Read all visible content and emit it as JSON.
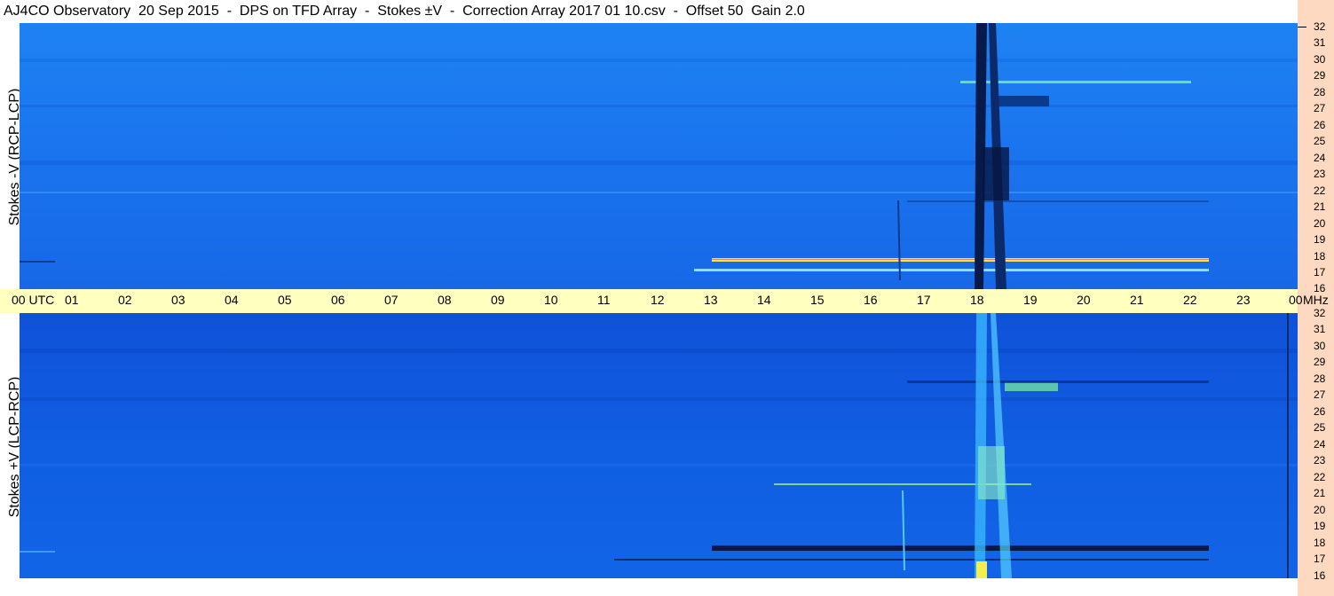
{
  "title": "AJ4CO Observatory  20 Sep 2015  -  DPS on TFD Array  -  Stokes ±V  -  Correction Array 2017 01 10.csv  -  Offset 50  Gain 2.0",
  "panels": {
    "top_label": "Stokes -V (RCP-LCP)",
    "bottom_label": "Stokes +V (LCP-RCP)"
  },
  "time_axis": {
    "labels": [
      "00  UTC",
      "01",
      "02",
      "03",
      "04",
      "05",
      "06",
      "07",
      "08",
      "09",
      "10",
      "11",
      "12",
      "13",
      "14",
      "15",
      "16",
      "17",
      "18",
      "19",
      "20",
      "21",
      "22",
      "23",
      "00"
    ]
  },
  "freq_axis": {
    "unit": "MHz",
    "labels": [
      "32",
      "31",
      "30",
      "29",
      "28",
      "27",
      "26",
      "25",
      "24",
      "23",
      "22",
      "21",
      "20",
      "19",
      "18",
      "17",
      "16"
    ]
  },
  "colors": {
    "top_background": "#1a75f0",
    "bottom_background": "#0f5ce0",
    "timebar": "#ffffc0",
    "freq_column": "#fcd9c0"
  }
}
